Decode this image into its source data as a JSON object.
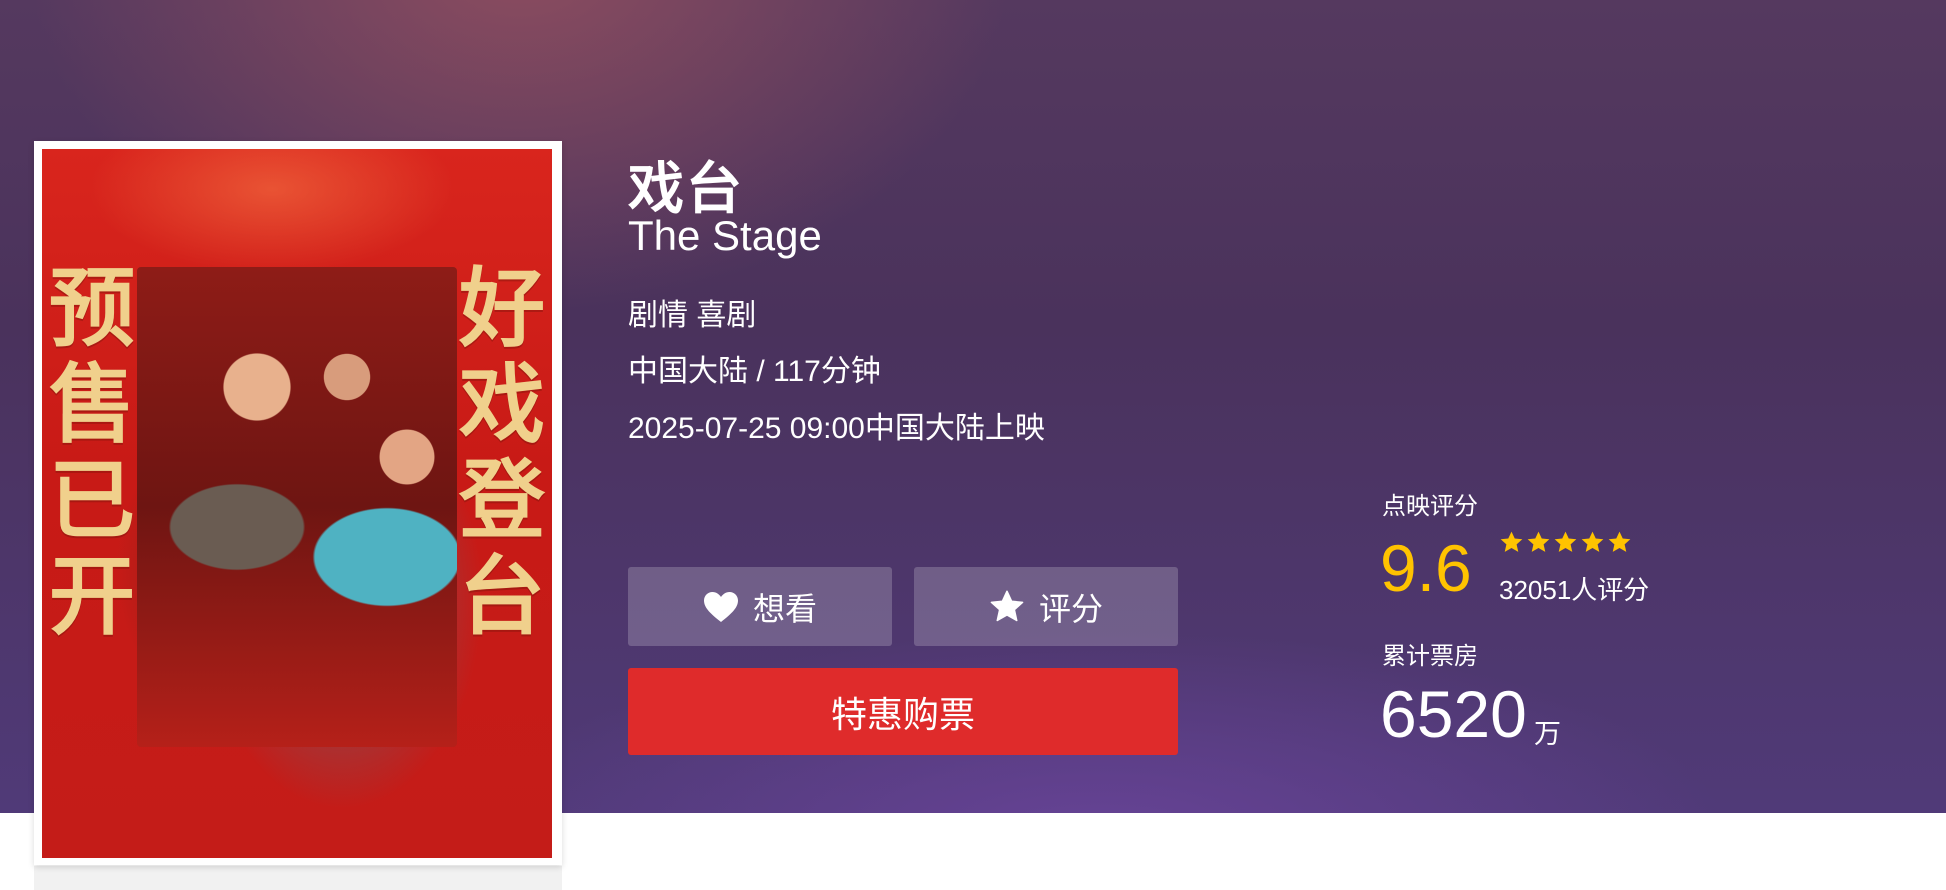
{
  "movie": {
    "title_cn": "戏台",
    "title_en": "The Stage",
    "genres": "剧情 喜剧",
    "region_duration": "中国大陆 / 117分钟",
    "release": "2025-07-25 09:00中国大陆上映",
    "poster": {
      "left_text": "预售已开",
      "right_text": "好戏登台"
    }
  },
  "actions": {
    "want_label": "想看",
    "rate_label": "评分",
    "buy_label": "特惠购票",
    "want_icon": "heart-icon",
    "rate_icon": "star-icon"
  },
  "stats": {
    "score_label": "点映评分",
    "score": "9.6",
    "stars": 5,
    "rating_count": "32051人评分",
    "box_label": "累计票房",
    "box_value": "6520",
    "box_unit": "万"
  },
  "colors": {
    "score": "#ffc300",
    "buy_button": "#df2b2b",
    "banner_top": "#55395f",
    "banner_bottom": "#503a78"
  }
}
